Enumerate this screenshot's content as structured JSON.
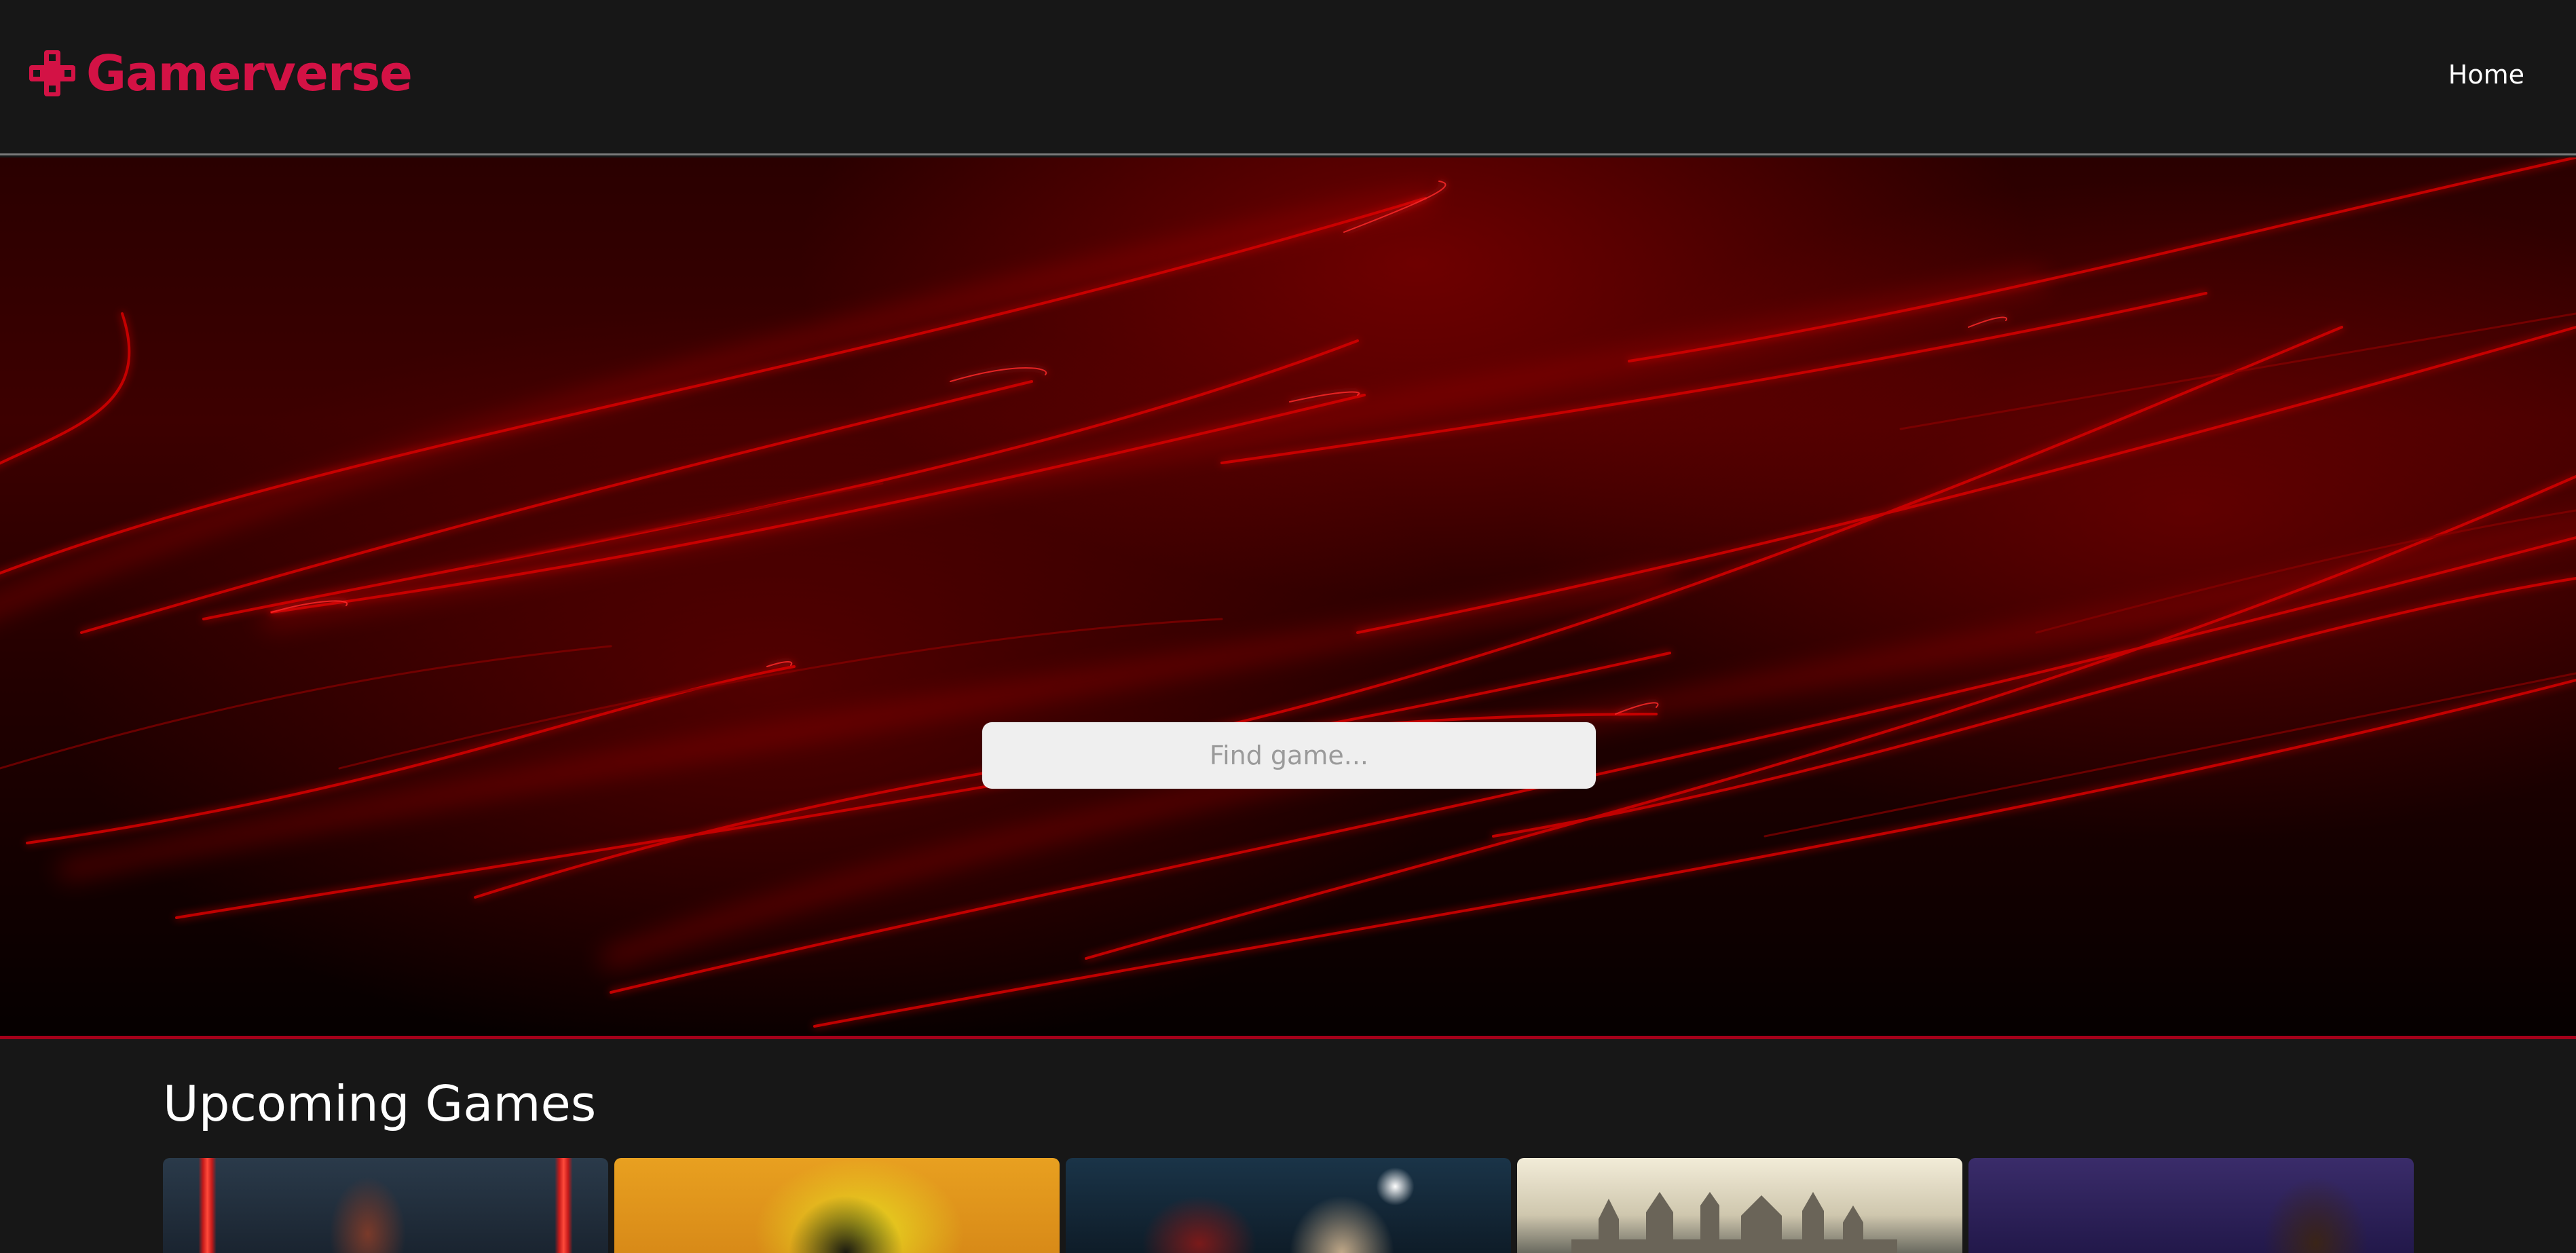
{
  "app": {
    "brand": "Gamerverse",
    "brand_color": "#d31245",
    "logo_icon": "gamepad-cross-icon"
  },
  "nav": {
    "home_label": "Home"
  },
  "search": {
    "placeholder": "Find game...",
    "value": ""
  },
  "sections": {
    "upcoming": {
      "title": "Upcoming Games",
      "cards": [
        {
          "id": "card-1"
        },
        {
          "id": "card-2"
        },
        {
          "id": "card-3"
        },
        {
          "id": "card-4"
        },
        {
          "id": "card-5"
        }
      ]
    }
  }
}
